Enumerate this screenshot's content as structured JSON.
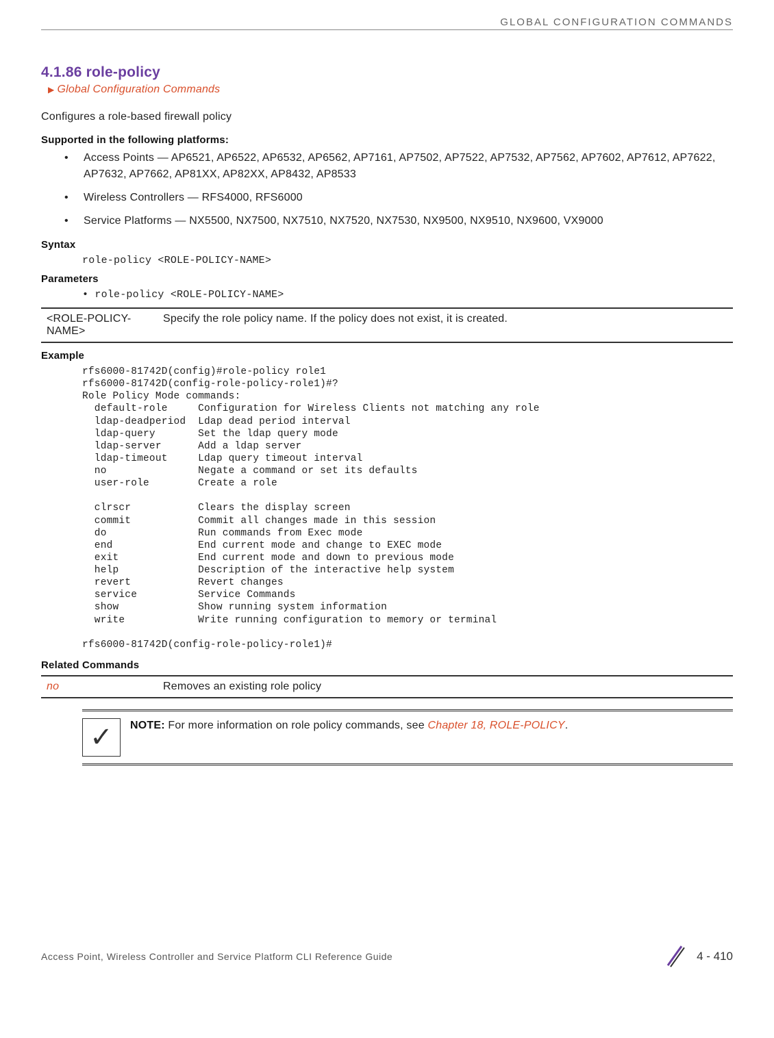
{
  "header": {
    "right_text": "GLOBAL CONFIGURATION COMMANDS"
  },
  "title": "4.1.86 role-policy",
  "breadcrumb": "Global Configuration Commands",
  "intro": "Configures a role-based firewall policy",
  "supported_heading": "Supported in the following platforms:",
  "platforms": [
    "Access Points — AP6521, AP6522, AP6532, AP6562, AP7161, AP7502, AP7522, AP7532, AP7562, AP7602, AP7612, AP7622, AP7632, AP7662, AP81XX, AP82XX, AP8432, AP8533",
    "Wireless Controllers — RFS4000, RFS6000",
    "Service Platforms — NX5500, NX7500, NX7510, NX7520, NX7530, NX9500, NX9510, NX9600, VX9000"
  ],
  "syntax_heading": "Syntax",
  "syntax_code": "role-policy <ROLE-POLICY-NAME>",
  "parameters_heading": "Parameters",
  "parameters_bullet": "• role-policy <ROLE-POLICY-NAME>",
  "param_table": {
    "name": "<ROLE-POLICY-NAME>",
    "desc": "Specify the role policy name. If the policy does not exist, it is created."
  },
  "example_heading": "Example",
  "example_code": "rfs6000-81742D(config)#role-policy role1\nrfs6000-81742D(config-role-policy-role1)#?\nRole Policy Mode commands:\n  default-role     Configuration for Wireless Clients not matching any role\n  ldap-deadperiod  Ldap dead period interval\n  ldap-query       Set the ldap query mode\n  ldap-server      Add a ldap server\n  ldap-timeout     Ldap query timeout interval\n  no               Negate a command or set its defaults\n  user-role        Create a role\n\n  clrscr           Clears the display screen\n  commit           Commit all changes made in this session\n  do               Run commands from Exec mode\n  end              End current mode and change to EXEC mode\n  exit             End current mode and down to previous mode\n  help             Description of the interactive help system\n  revert           Revert changes\n  service          Service Commands\n  show             Show running system information\n  write            Write running configuration to memory or terminal\n\nrfs6000-81742D(config-role-policy-role1)#",
  "related_heading": "Related Commands",
  "related": {
    "cmd": "no",
    "desc": "Removes an existing role policy"
  },
  "note": {
    "label": "NOTE:",
    "text_before": " For more information on role policy commands, see ",
    "link": "Chapter 18, ROLE-POLICY",
    "text_after": "."
  },
  "footer": {
    "left": "Access Point, Wireless Controller and Service Platform CLI Reference Guide",
    "page": "4 - 410"
  }
}
